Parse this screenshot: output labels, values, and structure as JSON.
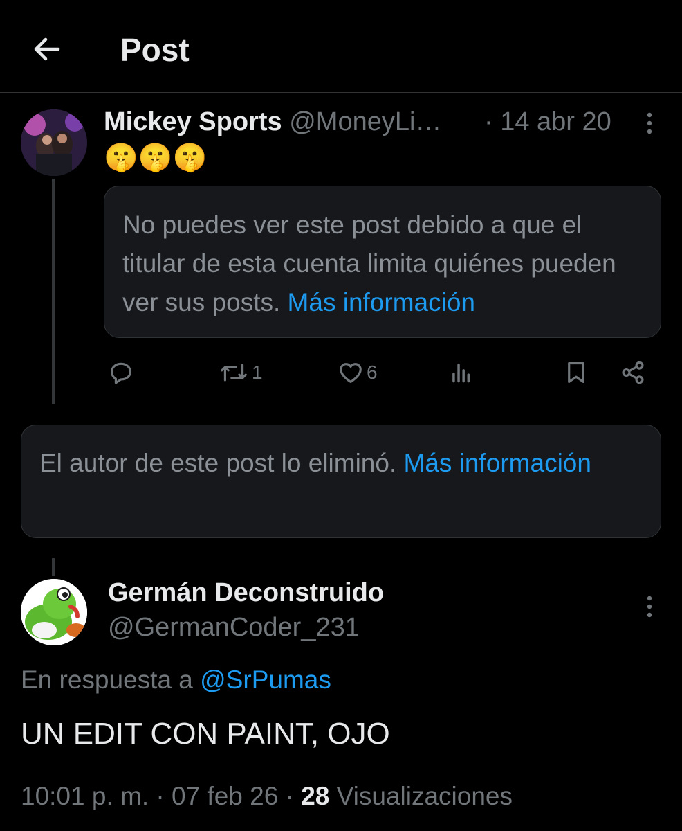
{
  "header": {
    "title": "Post",
    "back_icon": "arrow-left-icon"
  },
  "parent_post": {
    "display_name": "Mickey Sports",
    "handle": "@MoneyLi…",
    "date": "· 14 abr 20",
    "text": "🤫🤫🤫",
    "notice": {
      "text": "No puedes ver este post debido a que el titular de esta cuenta limita quiénes pueden ver sus posts.",
      "link": "Más información"
    },
    "actions": {
      "reply_count": "",
      "repost_count": "1",
      "like_count": "6",
      "views_count": ""
    }
  },
  "deleted_notice": {
    "text": "El autor de este post lo eliminó.",
    "link": "Más información"
  },
  "reply": {
    "display_name": "Germán Deconstruido",
    "handle": "@GermanCoder_231",
    "reply_to_prefix": "En respuesta a",
    "reply_to_handle": "@SrPumas",
    "text": "UN EDIT CON PAINT, OJO",
    "time": "10:01 p. m.",
    "date": "07 feb 26",
    "views_count": "28",
    "views_label": "Visualizaciones"
  },
  "colors": {
    "background": "#000000",
    "text_primary": "#e7e9ea",
    "text_secondary": "#71767b",
    "link": "#1d9bf0",
    "box_bg": "#16181c",
    "border": "#2f3336"
  }
}
